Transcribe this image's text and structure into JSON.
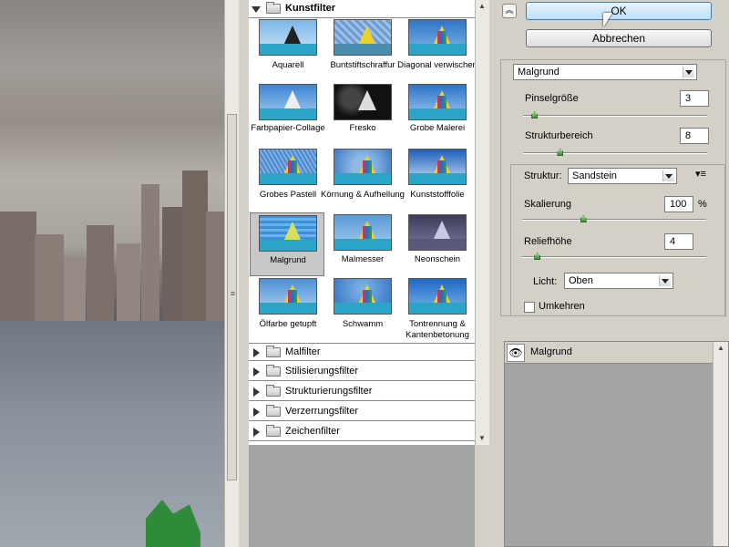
{
  "filter_gallery": {
    "open_category": "Kunstfilter",
    "thumbnails": [
      {
        "label": "Aquarell"
      },
      {
        "label": "Buntstiftschraffur"
      },
      {
        "label": "Diagonal verwischen"
      },
      {
        "label": "Farbpapier-Collage"
      },
      {
        "label": "Fresko"
      },
      {
        "label": "Grobe Malerei"
      },
      {
        "label": "Grobes Pastell"
      },
      {
        "label": "Körnung & Aufhellung"
      },
      {
        "label": "Kunststofffolie"
      },
      {
        "label": "Malgrund"
      },
      {
        "label": "Malmesser"
      },
      {
        "label": "Neonschein"
      },
      {
        "label": "Ölfarbe getupft"
      },
      {
        "label": "Schwamm"
      },
      {
        "label": "Tontrennung & Kantenbetonung"
      }
    ],
    "selected": "Malgrund",
    "collapsed_categories": [
      "Malfilter",
      "Stilisierungsfilter",
      "Strukturierungsfilter",
      "Verzerrungsfilter",
      "Zeichenfilter"
    ]
  },
  "buttons": {
    "ok": "OK",
    "cancel": "Abbrechen"
  },
  "settings": {
    "filter_select": "Malgrund",
    "brush_size": {
      "label": "Pinselgröße",
      "value": "3",
      "fraction": 0.06
    },
    "texture_coverage": {
      "label": "Strukturbereich",
      "value": "8",
      "fraction": 0.2
    },
    "texture": {
      "label": "Struktur:",
      "value": "Sandstein"
    },
    "scaling": {
      "label": "Skalierung",
      "value": "100",
      "unit": "%",
      "fraction": 0.33
    },
    "relief": {
      "label": "Reliefhöhe",
      "value": "4",
      "fraction": 0.08
    },
    "light": {
      "label": "Licht:",
      "value": "Oben"
    },
    "invert": {
      "label": "Umkehren",
      "checked": false
    }
  },
  "layers": {
    "effect_layer": "Malgrund"
  },
  "colors": {
    "selection": "#c8c8c8",
    "ok_button": "#bde0f7",
    "slider_knob": "#3d8f3a"
  }
}
